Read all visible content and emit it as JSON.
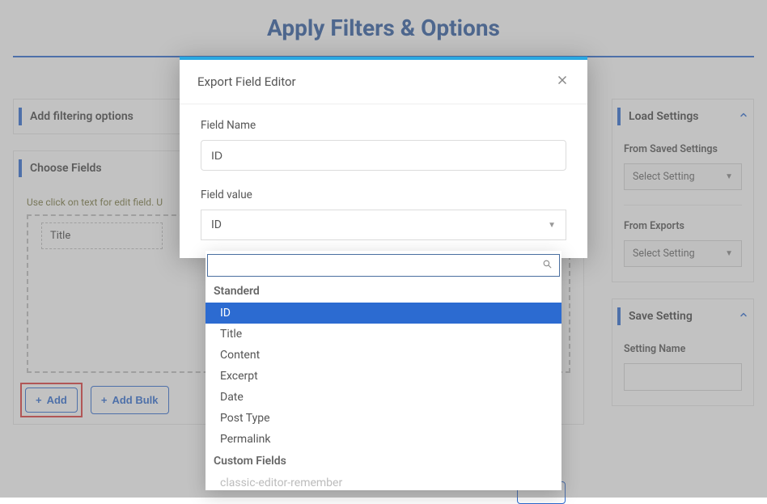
{
  "page": {
    "title": "Apply Filters & Options"
  },
  "left": {
    "panel_filter": {
      "title": "Add filtering options"
    },
    "panel_fields": {
      "title": "Choose Fields",
      "hint_prefix": "Use click on text for edit field. U",
      "chips": [
        "Title"
      ],
      "add_label": "Add",
      "add_bulk_label": "Add Bulk"
    }
  },
  "right": {
    "load": {
      "title": "Load Settings",
      "from_saved_label": "From Saved Settings",
      "from_saved_placeholder": "Select Setting",
      "from_exports_label": "From Exports",
      "from_exports_placeholder": "Select Setting"
    },
    "save": {
      "title": "Save Setting",
      "name_label": "Setting Name"
    }
  },
  "modal": {
    "title": "Export Field Editor",
    "field_name_label": "Field Name",
    "field_name_value": "ID",
    "field_value_label": "Field value",
    "field_value_selected": "ID"
  },
  "dropdown": {
    "search_value": "",
    "groups": [
      {
        "label": "Standerd",
        "items": [
          "ID",
          "Title",
          "Content",
          "Excerpt",
          "Date",
          "Post Type",
          "Permalink"
        ]
      },
      {
        "label": "Custom Fields",
        "items": [
          "classic-editor-remember"
        ]
      }
    ],
    "selected": "ID",
    "faded": [
      "classic-editor-remember"
    ]
  }
}
